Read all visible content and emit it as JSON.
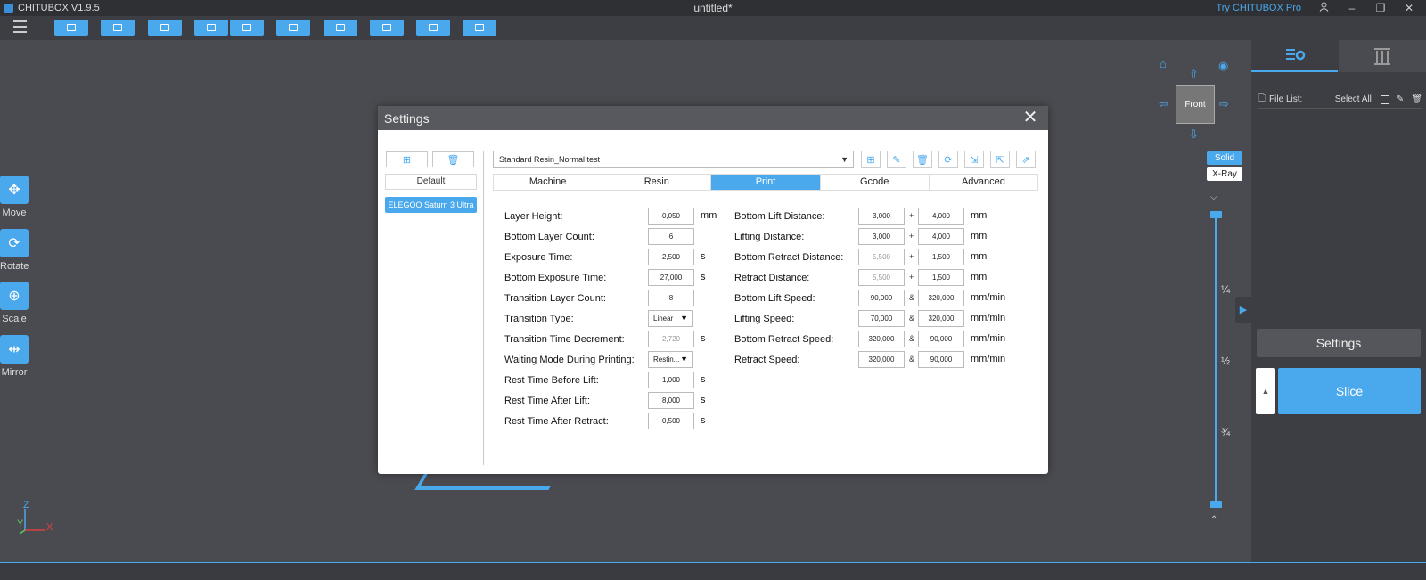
{
  "app": {
    "name": "CHITUBOX V1.9.5",
    "window_title": "untitled*",
    "try_pro": "Try CHITUBOX Pro"
  },
  "tools": [
    {
      "label": "Move",
      "icon": "move-icon"
    },
    {
      "label": "Rotate",
      "icon": "rotate-icon"
    },
    {
      "label": "Scale",
      "icon": "scale-icon"
    },
    {
      "label": "Mirror",
      "icon": "mirror-icon"
    }
  ],
  "viewport": {
    "nav_cube_label": "Front",
    "solid_label": "Solid",
    "xray_label": "X-Ray",
    "slider_marks": [
      "¼",
      "½",
      "¾"
    ],
    "axes": {
      "z": "Z",
      "y": "Y",
      "x": "X"
    }
  },
  "right_panel": {
    "file_list_label": "File List:",
    "select_all_label": "Select All",
    "settings_label": "Settings",
    "slice_label": "Slice"
  },
  "dialog": {
    "title": "Settings",
    "default_label": "Default",
    "printer": "ELEGOO Saturn 3 Ultra",
    "profile": "Standard Resin_Normal test",
    "tabs": [
      "Machine",
      "Resin",
      "Print",
      "Gcode",
      "Advanced"
    ],
    "active_tab": "Print",
    "left_params": [
      {
        "label": "Layer Height:",
        "value": "0,050",
        "unit": "mm"
      },
      {
        "label": "Bottom Layer Count:",
        "value": "6",
        "unit": ""
      },
      {
        "label": "Exposure Time:",
        "value": "2,500",
        "unit": "s"
      },
      {
        "label": "Bottom Exposure Time:",
        "value": "27,000",
        "unit": "s"
      },
      {
        "label": "Transition Layer Count:",
        "value": "8",
        "unit": ""
      },
      {
        "label": "Transition Type:",
        "value": "Linear",
        "unit": ""
      },
      {
        "label": "Transition Time Decrement:",
        "value": "2,720",
        "unit": "s"
      },
      {
        "label": "Waiting Mode During Printing:",
        "value": "Restin...",
        "unit": ""
      },
      {
        "label": "Rest Time Before Lift:",
        "value": "1,000",
        "unit": "s"
      },
      {
        "label": "Rest Time After Lift:",
        "value": "8,000",
        "unit": "s"
      },
      {
        "label": "Rest Time After Retract:",
        "value": "0,500",
        "unit": "s"
      }
    ],
    "right_params": [
      {
        "label": "Bottom Lift Distance:",
        "v1": "3,000",
        "sym": "+",
        "v2": "4,000",
        "unit": "mm"
      },
      {
        "label": "Lifting Distance:",
        "v1": "3,000",
        "sym": "+",
        "v2": "4,000",
        "unit": "mm"
      },
      {
        "label": "Bottom Retract Distance:",
        "v1": "5,500",
        "sym": "+",
        "v2": "1,500",
        "unit": "mm"
      },
      {
        "label": "Retract Distance:",
        "v1": "5,500",
        "sym": "+",
        "v2": "1,500",
        "unit": "mm"
      },
      {
        "label": "Bottom Lift Speed:",
        "v1": "90,000",
        "sym": "&",
        "v2": "320,000",
        "unit": "mm/min"
      },
      {
        "label": "Lifting Speed:",
        "v1": "70,000",
        "sym": "&",
        "v2": "320,000",
        "unit": "mm/min"
      },
      {
        "label": "Bottom Retract Speed:",
        "v1": "320,000",
        "sym": "&",
        "v2": "90,000",
        "unit": "mm/min"
      },
      {
        "label": "Retract Speed:",
        "v1": "320,000",
        "sym": "&",
        "v2": "90,000",
        "unit": "mm/min"
      }
    ]
  },
  "colors": {
    "accent": "#4aa8ec",
    "dark_bg": "#4a4b50",
    "panel_bg": "#3d3e43"
  }
}
